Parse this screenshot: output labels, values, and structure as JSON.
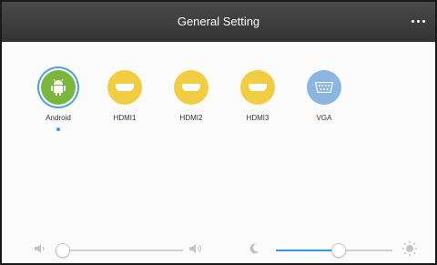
{
  "header": {
    "title": "General Setting",
    "menu_icon": "more-dots-icon"
  },
  "sources": [
    {
      "label": "Android",
      "icon": "android-icon",
      "color": "#7ab53c",
      "selected": true
    },
    {
      "label": "HDMI1",
      "icon": "hdmi-port-icon",
      "color": "#f3cd41",
      "selected": false
    },
    {
      "label": "HDMI2",
      "icon": "hdmi-port-icon",
      "color": "#f3cd41",
      "selected": false
    },
    {
      "label": "HDMI3",
      "icon": "hdmi-port-icon",
      "color": "#f3cd41",
      "selected": false
    },
    {
      "label": "VGA",
      "icon": "vga-port-icon",
      "color": "#8cb6e2",
      "selected": false
    }
  ],
  "volume": {
    "level": 0.03,
    "low_icon": "volume-low-icon",
    "high_icon": "volume-high-icon"
  },
  "brightness": {
    "level": 0.54,
    "low_icon": "moon-icon",
    "high_icon": "sun-icon",
    "accent": "#2d9ce6"
  },
  "colors": {
    "selection_ring": "#4da3e0",
    "selected_dot": "#2d9ce6"
  }
}
